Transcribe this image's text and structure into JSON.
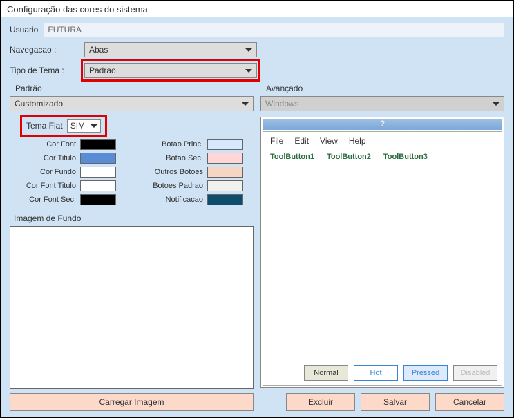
{
  "title": "Configuração das cores do sistema",
  "labels": {
    "usuario": "Usuario",
    "navegacao": "Navegacao  :",
    "tipotema": "Tipo de Tema   :",
    "padrao": "Padrão",
    "avancado": "Avançado",
    "temaflat": "Tema Flat",
    "imagemfundo": "Imagem de Fundo"
  },
  "user_value": "FUTURA",
  "nav_value": "Abas",
  "tema_value": "Padrao",
  "padrao_preset": "Customizado",
  "temaflat_value": "SIM",
  "avancado_value": "Windows",
  "colors_left": [
    {
      "label": "Cor Font",
      "hex": "#000000"
    },
    {
      "label": "Cor Titulo",
      "hex": "#5a8cd6"
    },
    {
      "label": "Cor Fundo",
      "hex": "#ffffff"
    },
    {
      "label": "Cor Font Titulo",
      "hex": "#ffffff"
    },
    {
      "label": "Cor Font Sec.",
      "hex": "#000000"
    }
  ],
  "colors_right": [
    {
      "label": "Botao Princ.",
      "hex": "#d6e9ff"
    },
    {
      "label": "Botao Sec.",
      "hex": "#ffd6d6"
    },
    {
      "label": "Outros Botoes",
      "hex": "#f5d6c2"
    },
    {
      "label": "Botoes Padrao",
      "hex": "#f0f0ee"
    },
    {
      "label": "Notificacao",
      "hex": "#0f4c6b"
    }
  ],
  "preview": {
    "header_q": "?",
    "menu": {
      "file": "File",
      "edit": "Edit",
      "view": "View",
      "help": "Help"
    },
    "toolbtns": {
      "b1": "ToolButton1",
      "b2": "ToolButton2",
      "b3": "ToolButton3"
    },
    "states": {
      "normal": "Normal",
      "hot": "Hot",
      "pressed": "Pressed",
      "disabled": "Disabled"
    }
  },
  "buttons": {
    "carregar": "Carregar Imagem",
    "excluir": "Excluir",
    "salvar": "Salvar",
    "cancelar": "Cancelar"
  }
}
